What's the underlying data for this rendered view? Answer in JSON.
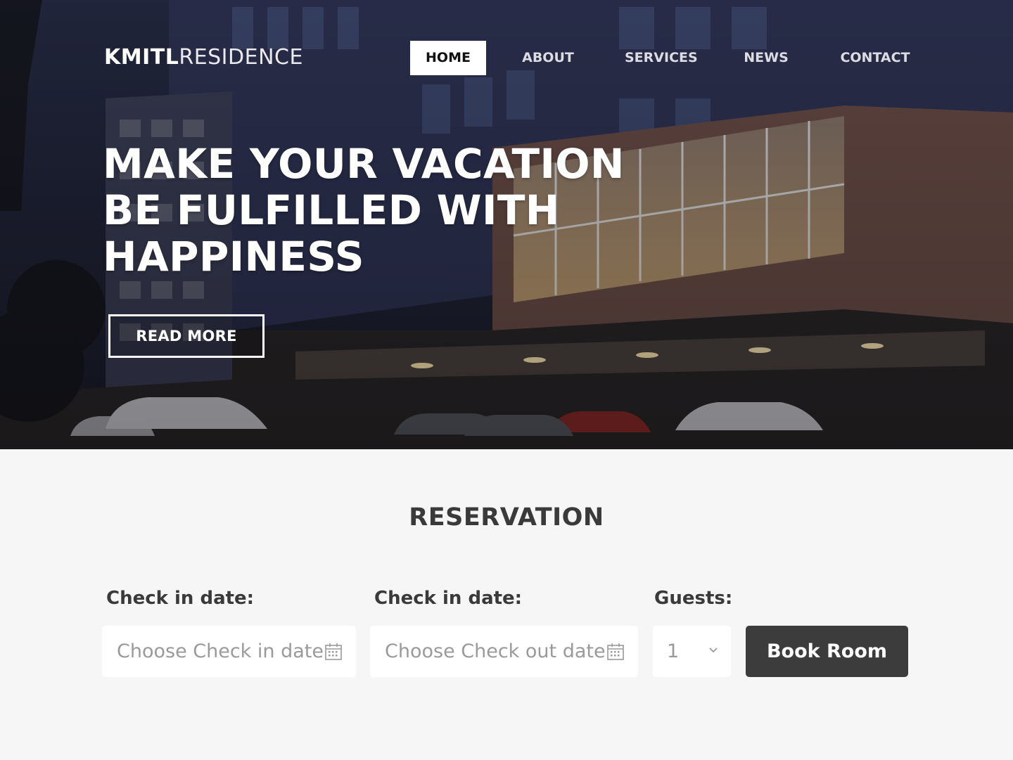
{
  "header": {
    "logo_bold": "KMITL",
    "logo_light": "RESIDENCE",
    "nav": [
      {
        "label": "HOME",
        "active": true
      },
      {
        "label": "ABOUT",
        "active": false
      },
      {
        "label": "SERVICES",
        "active": false
      },
      {
        "label": "NEWS",
        "active": false
      },
      {
        "label": "CONTACT",
        "active": false
      }
    ]
  },
  "hero": {
    "headline_lines": [
      "MAKE YOUR VACATION",
      "BE FULFILLED WITH",
      "HAPPINESS"
    ],
    "cta_label": "READ MORE"
  },
  "reservation": {
    "title": "RESERVATION",
    "check_in_label": "Check in date:",
    "check_in_placeholder": "Choose Check in date",
    "check_out_label": "Check in date:",
    "check_out_placeholder": "Choose Check out date",
    "guests_label": "Guests:",
    "guests_value": "1",
    "book_label": "Book Room"
  },
  "icons": {
    "calendar": "calendar-icon",
    "dropdown": "chevron-down-icon"
  },
  "colors": {
    "page_bg": "#f6f6f6",
    "text_dark": "#3a3a3a",
    "button_dark": "#3c3c3c",
    "placeholder": "#9a9a9a"
  }
}
